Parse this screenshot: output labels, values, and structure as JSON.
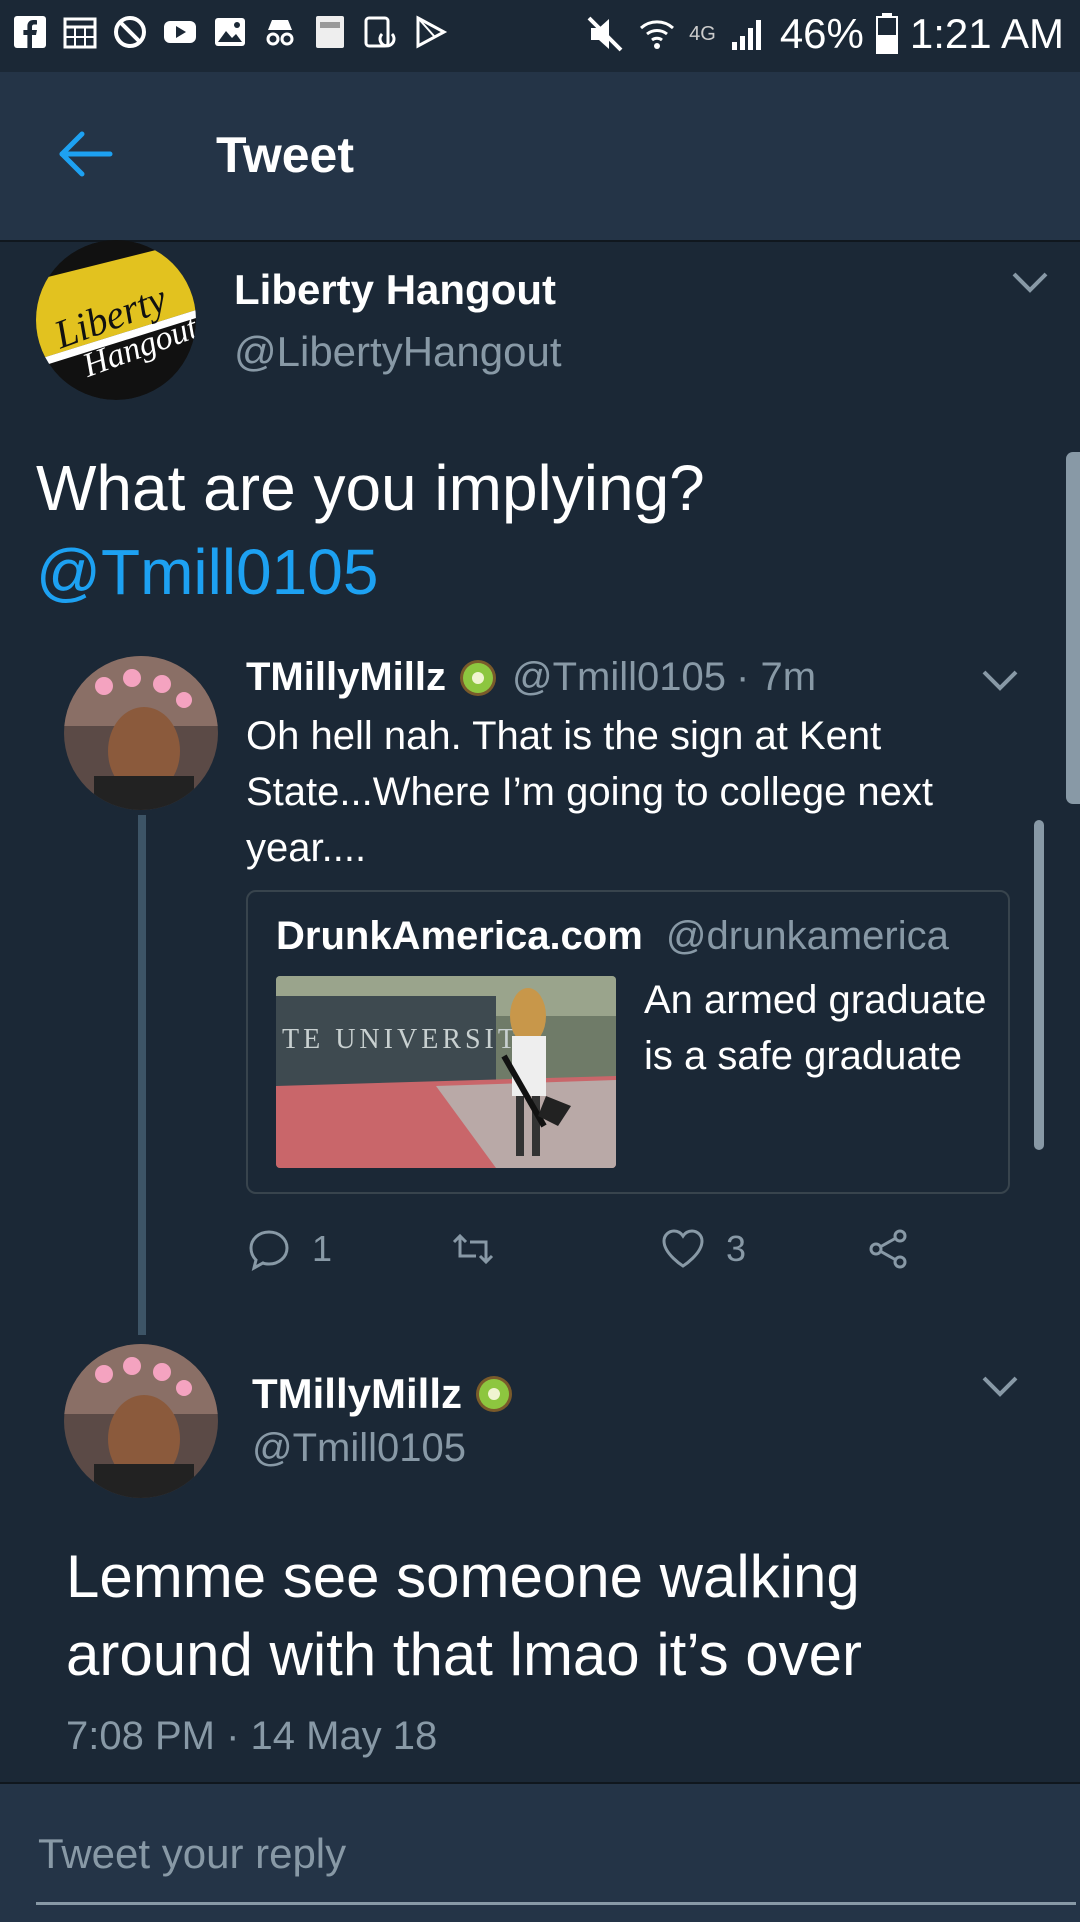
{
  "status_bar": {
    "battery": "46%",
    "time": "1:21 AM",
    "network": "4G"
  },
  "app_bar": {
    "title": "Tweet"
  },
  "main_tweet": {
    "name": "Liberty Hangout",
    "handle": "@LibertyHangout",
    "avatar_text_1": "Liberty",
    "avatar_text_2": "Hangout",
    "text": "What are you implying?",
    "mention": "@Tmill0105"
  },
  "reply_tweet": {
    "name": "TMillyMillz",
    "handle": "@Tmill0105",
    "time": "· 7m",
    "text": "Oh hell nah. That is the sign at Kent State...Where I’m going to college next year....",
    "quote": {
      "name": "DrunkAmerica.com",
      "handle": "@drunkamerica",
      "text": "An armed graduate is a safe graduate",
      "image_sign_text": "TE UNIVERSITY"
    },
    "actions": {
      "reply_count": "1",
      "retweet_count": "",
      "like_count": "3"
    }
  },
  "main_reply": {
    "name": "TMillyMillz",
    "handle": "@Tmill0105",
    "text": "Lemme see someone walking around with that lmao it’s over",
    "timestamp": "7:08 PM · 14 May 18"
  },
  "reply_bar": {
    "placeholder": "Tweet your reply"
  },
  "colors": {
    "background": "#1b2836",
    "app_bar": "#243447",
    "link": "#1da1f2",
    "secondary_text": "#8899a6"
  }
}
